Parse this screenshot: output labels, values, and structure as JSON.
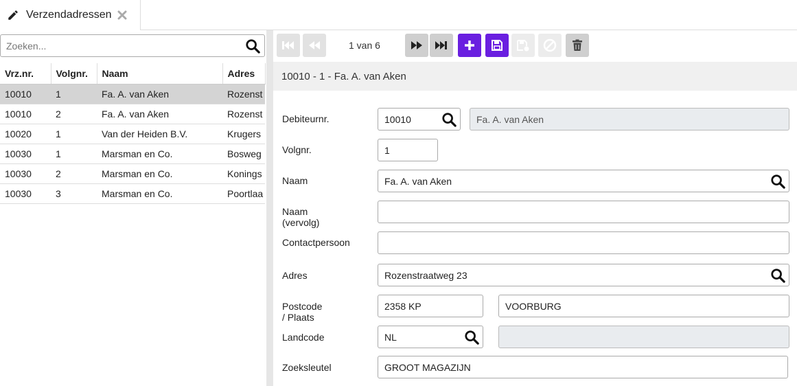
{
  "tab": {
    "title": "Verzendadressen",
    "icons": [
      "pencil-icon",
      "close-icon"
    ]
  },
  "search": {
    "placeholder": "Zoeken..."
  },
  "table": {
    "columns": [
      "Vrz.nr.",
      "Volgnr.",
      "Naam",
      "Adres"
    ],
    "rows": [
      [
        "10010",
        "1",
        "Fa. A. van Aken",
        "Rozenst"
      ],
      [
        "10010",
        "2",
        "Fa. A. van Aken",
        "Rozenst"
      ],
      [
        "10020",
        "1",
        "Van der Heiden B.V.",
        "Krugers"
      ],
      [
        "10030",
        "1",
        "Marsman en Co.",
        "Bosweg"
      ],
      [
        "10030",
        "2",
        "Marsman en Co.",
        "Konings"
      ],
      [
        "10030",
        "3",
        "Marsman en Co.",
        "Poortlaa"
      ]
    ],
    "selected_row": 0
  },
  "toolbar": {
    "pager_text": "1 van 6",
    "buttons": [
      "first-icon",
      "previous-icon",
      "next-icon",
      "last-icon",
      "add-icon",
      "save-icon",
      "save-as-icon",
      "cancel-icon",
      "delete-icon"
    ]
  },
  "record_header": "10010 - 1 - Fa. A. van Aken",
  "form": {
    "debiteurnr": {
      "label": "Debiteurnr.",
      "value": "10010",
      "name": "Fa. A. van Aken"
    },
    "volgnr": {
      "label": "Volgnr.",
      "value": "1"
    },
    "naam": {
      "label": "Naam",
      "value": "Fa. A. van Aken"
    },
    "naam_vervolg": {
      "label": "Naam (vervolg)",
      "value": ""
    },
    "contactpersoon": {
      "label": "Contactpersoon",
      "value": ""
    },
    "adres": {
      "label": "Adres",
      "value": "Rozenstraatweg 23"
    },
    "postcode_plaats": {
      "label": "Postcode / Plaats",
      "postcode": "2358 KP",
      "plaats": "VOORBURG"
    },
    "landcode": {
      "label": "Landcode",
      "value": "NL",
      "description": ""
    },
    "zoeksleutel": {
      "label": "Zoeksleutel",
      "value": "GROOT MAGAZIJN"
    }
  },
  "colors": {
    "accent": "#6a1fe0",
    "selected_row": "#d4d4d4",
    "header_band": "#f0f0f0"
  }
}
